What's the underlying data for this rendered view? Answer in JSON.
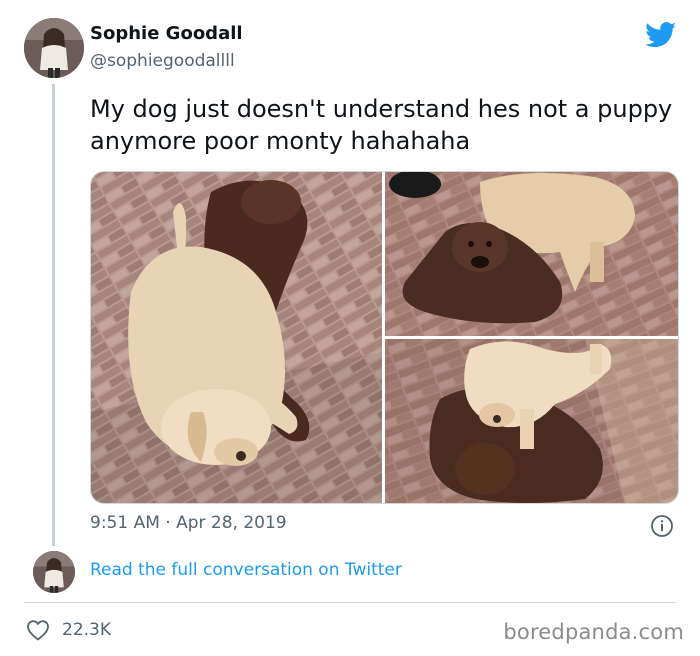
{
  "author": {
    "display_name": "Sophie Goodall",
    "handle": "@sophiegoodallll"
  },
  "tweet": {
    "text": "My dog just doesn't understand hes not a puppy anymore poor monty hahahaha",
    "timestamp": "9:51 AM · Apr 28, 2019"
  },
  "media": {
    "photo_count": 3
  },
  "footer": {
    "read_full_label": "Read the full conversation on Twitter",
    "like_count": "22.3K"
  },
  "watermark": "boredpanda.com",
  "icons": {
    "brand": "twitter-bird-icon",
    "info": "info-icon",
    "like": "heart-icon"
  },
  "colors": {
    "link": "#1d9bf0",
    "secondary_text": "#536471",
    "primary_text": "#0f1419",
    "border": "#cfd9de"
  }
}
